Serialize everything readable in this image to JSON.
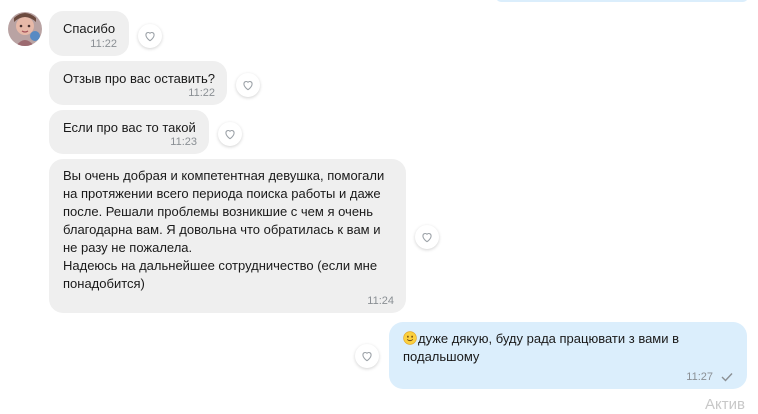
{
  "messages": [
    {
      "text": "Спасибо",
      "time": "11:22"
    },
    {
      "text": "Отзыв про вас оставить?",
      "time": "11:22"
    },
    {
      "text": "Если про вас то такой",
      "time": "11:23"
    },
    {
      "text": "Вы очень добрая и компетентная девушка, помогали\nна протяжении всего периода поиска работы и даже\nпосле. Решали проблемы возникшие с чем я очень\nблагодарна вам. Я довольна что обратилась к вам и\nне разу не пожалела.\nНадеюсь на дальнейшее сотрудничество (если мне\nпонадобится)",
      "time": "11:24"
    },
    {
      "text": "дуже дякую, буду рада працювати з вами в\nподальшому",
      "time": "11:27",
      "emoji": "slightly-smiling-face-icon"
    }
  ],
  "watermark": "Актив",
  "colors": {
    "incoming_bubble": "#efefef",
    "outgoing_bubble": "#dbeefc",
    "timestamp": "#8a8f94",
    "heart_outline": "#9aa0a6"
  },
  "icons": {
    "like": "heart-outline-icon",
    "read_receipt": "check-icon"
  }
}
